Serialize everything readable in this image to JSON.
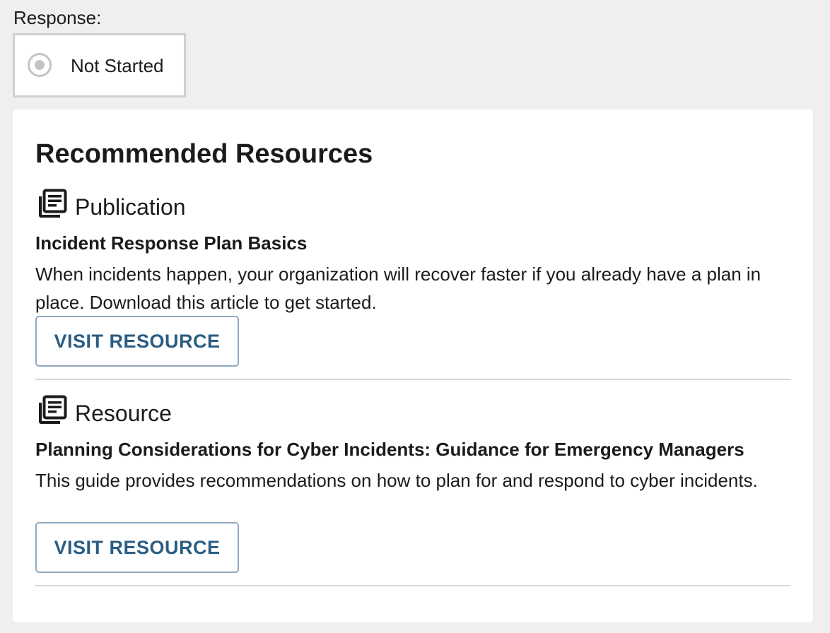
{
  "response": {
    "label": "Response:",
    "status": "Not Started"
  },
  "recommended": {
    "title": "Recommended Resources",
    "resources": [
      {
        "type": "Publication",
        "type_icon": "book-icon",
        "title": "Incident Response Plan Basics",
        "description": "When incidents happen, your organization will recover faster if you already have a plan in place. Download this article to get started.",
        "button_label": "VISIT RESOURCE"
      },
      {
        "type": "Resource",
        "type_icon": "book-icon",
        "title": "Planning Considerations for Cyber Incidents: Guidance for Emergency Managers",
        "description": "This guide provides recommendations on how to plan for and respond to cyber incidents.",
        "button_label": "VISIT RESOURCE"
      }
    ]
  },
  "colors": {
    "page_background": "#efefef",
    "card_background": "#ffffff",
    "button_text": "#2a5d84",
    "button_border": "#8fa9bf",
    "radio_gray": "#c4c4c4"
  }
}
